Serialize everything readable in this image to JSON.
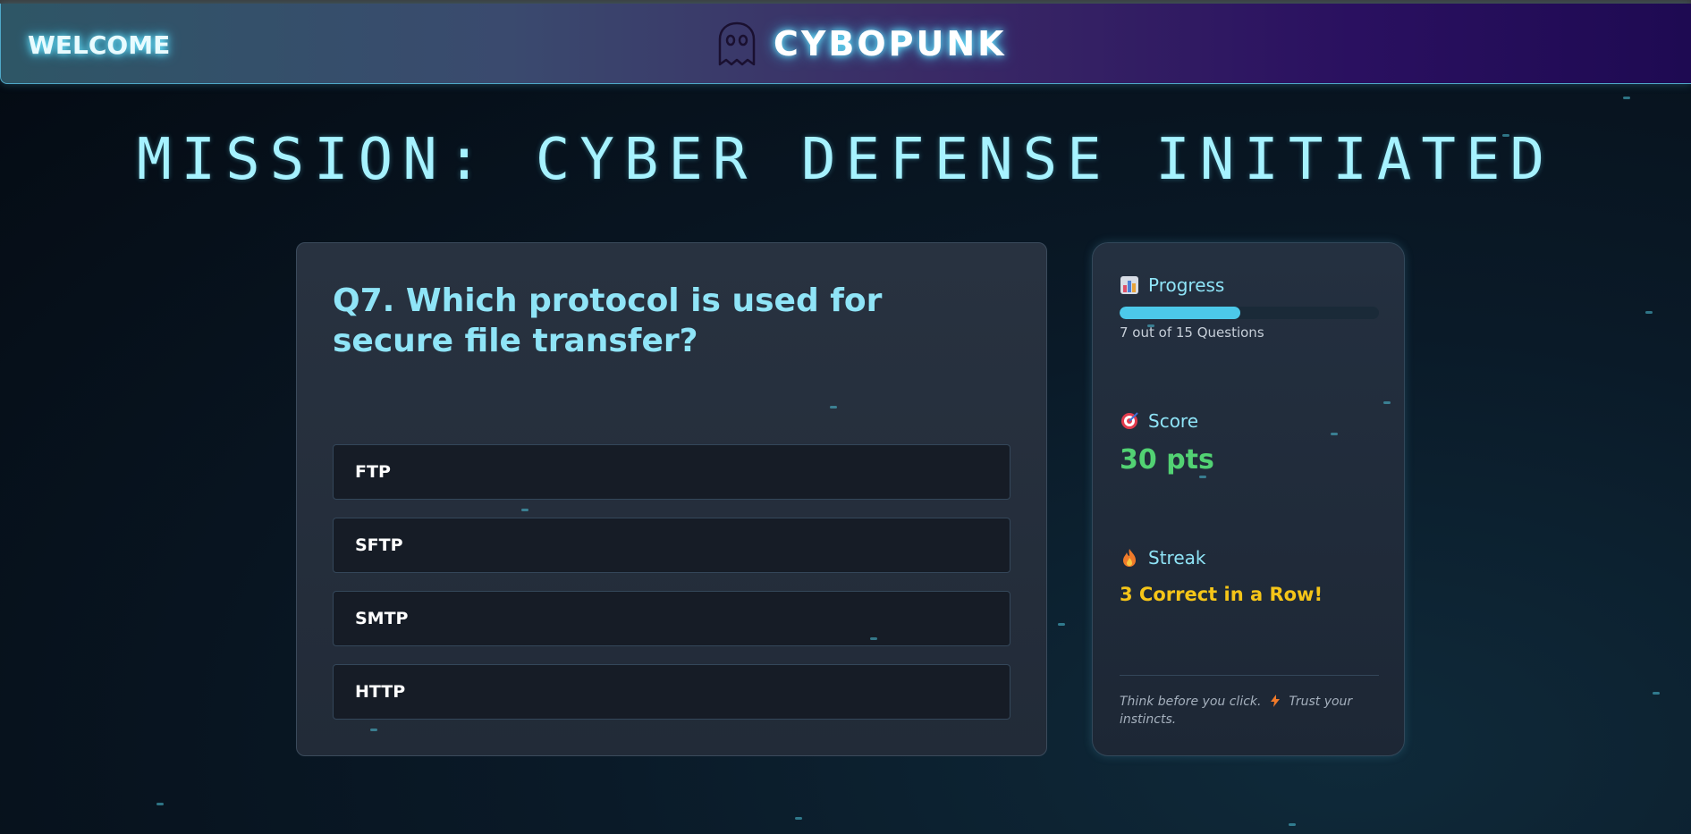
{
  "header": {
    "welcome_label": "WELCOME",
    "brand_name": "CYBOPUNK",
    "brand_icon": "ghost-icon"
  },
  "mission_title": "MISSION: CYBER DEFENSE INITIATED",
  "question": {
    "text": "Q7. Which protocol is used for secure file transfer?",
    "options": [
      "FTP",
      "SFTP",
      "SMTP",
      "HTTP"
    ]
  },
  "stats": {
    "progress": {
      "label": "Progress",
      "icon": "bar-chart-icon",
      "current": 7,
      "total": 15,
      "caption": "7 out of 15 Questions"
    },
    "score": {
      "label": "Score",
      "icon": "target-icon",
      "value": "30 pts"
    },
    "streak": {
      "label": "Streak",
      "icon": "fire-icon",
      "value": "3 Correct in a Row!"
    },
    "tip": {
      "part1": "Think before you click.",
      "icon": "lightning-icon",
      "part2": "Trust your instincts."
    }
  },
  "colors": {
    "accent": "#8fe4f7",
    "score": "#52d273",
    "streak": "#f5c518",
    "progress_fill": "#4cc9ea"
  }
}
